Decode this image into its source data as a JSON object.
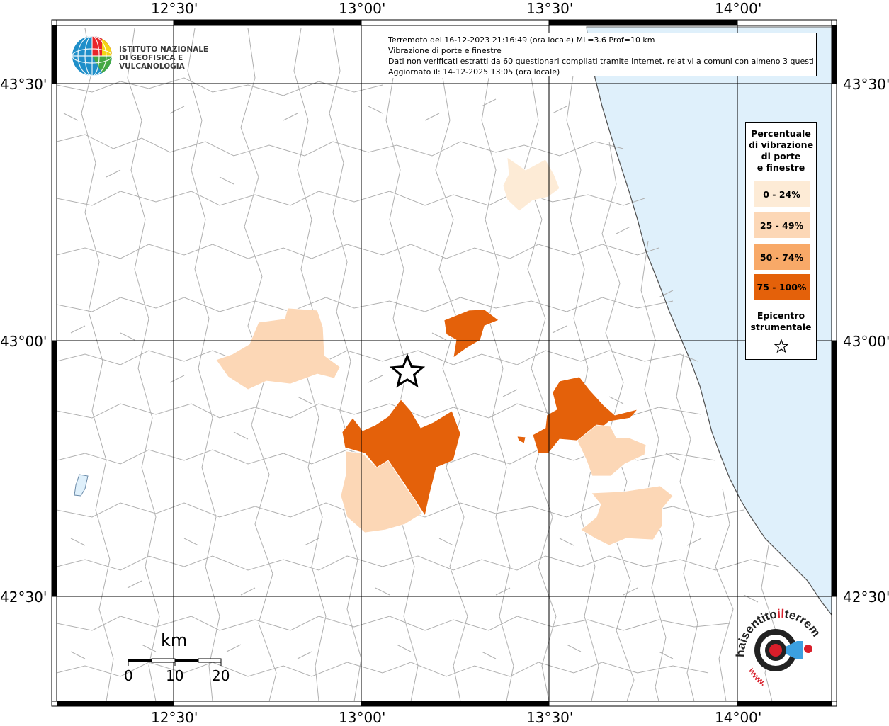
{
  "title_box": {
    "line1": "Terremoto del 16-12-2023 21:16:49 (ora locale) ML=3.6 Prof=10 km",
    "line2": "Vibrazione di porte e finestre",
    "line3": "Dati non verificati estratti da 60 questionari compilati tramite Internet, relativi a comuni con almeno 3 questionari.",
    "line4": "Aggiornato il: 14-12-2025 13:05 (ora locale)"
  },
  "logo": {
    "line1": "ISTITUTO NAZIONALE",
    "line2": "DI GEOFISICA E VULCANOLOGIA"
  },
  "axes": {
    "top_lon": [
      "12°30'",
      "13°00'",
      "13°30'",
      "14°00'"
    ],
    "bottom_lon": [
      "12°30'",
      "13°00'",
      "13°30'",
      "14°00'"
    ],
    "left_lat": [
      "43°30'",
      "43°00'",
      "42°30'"
    ],
    "right_lat": [
      "43°30'",
      "43°00'",
      "42°30'"
    ]
  },
  "legend": {
    "title": [
      "Percentuale",
      "di vibrazione",
      "di porte",
      "e finestre"
    ],
    "classes": [
      {
        "label": "0 - 24%",
        "color": "#fdebd6"
      },
      {
        "label": "25 - 49%",
        "color": "#fcd7b6"
      },
      {
        "label": "50 - 74%",
        "color": "#f8a968"
      },
      {
        "label": "75 - 100%",
        "color": "#e4610a"
      }
    ],
    "epicenter_title": [
      "Epicentro",
      "strumentale"
    ]
  },
  "scale_bar": {
    "unit": "km",
    "labels": [
      "0",
      "10",
      "20"
    ]
  },
  "colors": {
    "sea": "#dff0fb",
    "land": "#ffffff",
    "boundary": "#a8a8a8",
    "grid": "#000000"
  },
  "icons": {
    "epicenter": "star-icon",
    "hst_logo": "haisentitoilterremoto-logo"
  }
}
